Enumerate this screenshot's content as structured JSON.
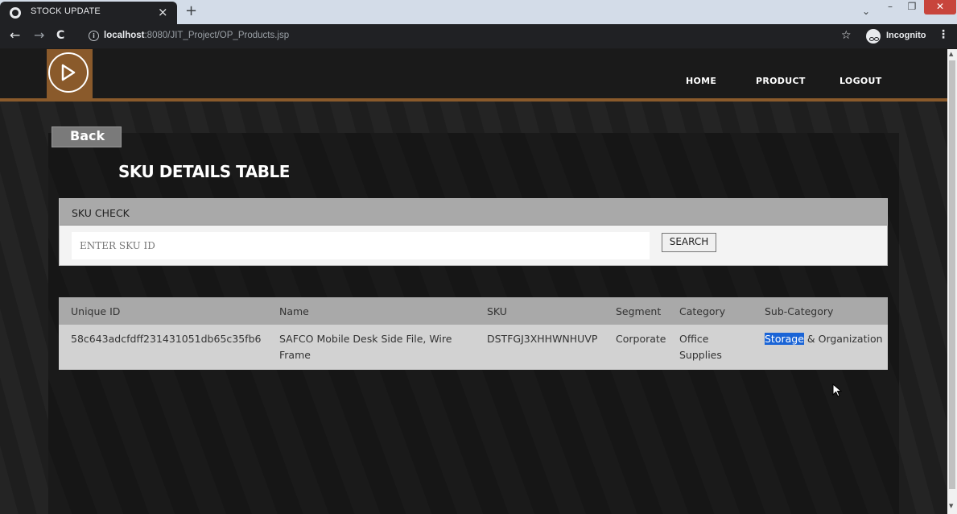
{
  "browser": {
    "tab_title": "STOCK UPDATE",
    "tab_close": "×",
    "new_tab": "+",
    "url_host": "localhost",
    "url_path": ":8080/JIT_Project/OP_Products.jsp",
    "incognito_label": "Incognito",
    "nav_back": "←",
    "nav_forward": "→",
    "reload": "C",
    "star": "☆",
    "menu": "⋮",
    "window_dropdown": "⌄",
    "window_min": "–",
    "window_max": "❐",
    "window_close": "✕"
  },
  "header": {
    "nav": [
      "HOME",
      "PRODUCT",
      "LOGOUT"
    ]
  },
  "page": {
    "back_label": "Back",
    "heading": "SKU DETAILS TABLE"
  },
  "sku_check": {
    "title": "SKU CHECK",
    "input_placeholder": "ENTER SKU ID",
    "input_value": "",
    "search_label": "SEARCH"
  },
  "table": {
    "columns": [
      "Unique ID",
      "Name",
      "SKU",
      "Segment",
      "Category",
      "Sub-Category"
    ],
    "rows": [
      {
        "unique_id": "58c643adcfdff231431051db65c35fb6",
        "name": "SAFCO Mobile Desk Side File, Wire Frame",
        "sku": "DSTFGJ3XHHWNHUVP",
        "segment": "Corporate",
        "category": "Office Supplies",
        "sub_category_selected": "Storage",
        "sub_category_rest": " & Organization"
      }
    ]
  },
  "colors": {
    "accent": "#8a5a2b",
    "header_bar": "#a9a9a9",
    "selection": "#1a64d6"
  }
}
